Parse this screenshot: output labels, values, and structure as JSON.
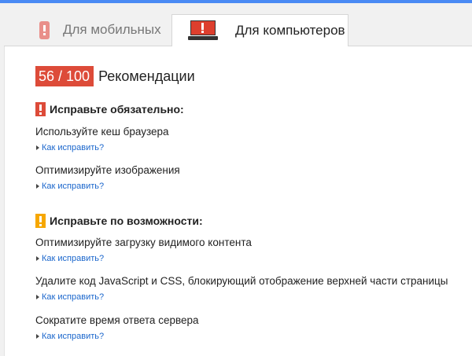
{
  "tabs": {
    "mobile": "Для мобильных",
    "desktop": "Для компьютеров"
  },
  "score": {
    "value": "56 / 100",
    "label": "Рекомендации"
  },
  "must_fix": {
    "heading": "Исправьте обязательно:",
    "items": [
      {
        "title": "Используйте кеш браузера",
        "link": "Как исправить?"
      },
      {
        "title": "Оптимизируйте изображения",
        "link": "Как исправить?"
      }
    ]
  },
  "should_fix": {
    "heading": "Исправьте по возможности:",
    "items": [
      {
        "title": "Оптимизируйте загрузку видимого контента",
        "link": "Как исправить?"
      },
      {
        "title": "Удалите код JavaScript и CSS, блокирующий отображение верхней части страницы",
        "link": "Как исправить?"
      },
      {
        "title": "Сократите время ответа сервера",
        "link": "Как исправить?"
      }
    ]
  },
  "icons": {
    "mobile_tab": "phone-icon",
    "desktop_tab": "monitor-icon",
    "must_fix": "exclamation-icon",
    "should_fix": "exclamation-icon",
    "link_expand": "triangle-right-icon"
  },
  "colors": {
    "score_badge": "#dd4b39",
    "must_fix_flag": "#dd4b39",
    "should_fix_flag": "#f6a700",
    "link": "#1a66cc",
    "top_accent": "#4a8af4"
  }
}
